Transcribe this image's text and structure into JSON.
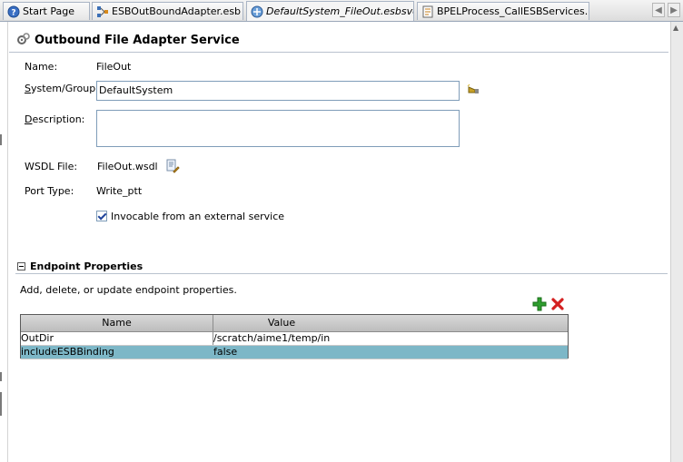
{
  "tabs": [
    {
      "label": "Start Page",
      "icon": "help-icon"
    },
    {
      "label": "ESBOutBoundAdapter.esb",
      "icon": "esb-diagram-icon"
    },
    {
      "label": "DefaultSystem_FileOut.esbsvc",
      "icon": "service-icon"
    },
    {
      "label": "BPELProcess_CallESBServices.bpel",
      "icon": "bpel-icon"
    }
  ],
  "header": {
    "title": "Outbound File Adapter Service"
  },
  "form": {
    "name_label": "Name:",
    "name_value": "FileOut",
    "system_label_u": "S",
    "system_label_rest": "ystem/Group:",
    "system_value": "DefaultSystem",
    "description_label_u": "D",
    "description_label_rest": "escription:",
    "description_value": "",
    "wsdl_label": "WSDL File:",
    "wsdl_value": "FileOut.wsdl",
    "port_label": "Port Type:",
    "port_value": "Write_ptt",
    "invocable_label": "Invocable from an external service",
    "invocable_checked": true
  },
  "endpoint": {
    "title": "Endpoint Properties",
    "description": "Add, delete, or update endpoint properties.",
    "columns": [
      "Name",
      "Value"
    ],
    "rows": [
      {
        "name": "OutDir",
        "value": "/scratch/aime1/temp/in",
        "selected": false
      },
      {
        "name": "includeESBBinding",
        "value": "false",
        "selected": true
      }
    ]
  },
  "colors": {
    "selected_row": "#7db7c7",
    "add": "#2e9e2e",
    "delete": "#d42020"
  }
}
